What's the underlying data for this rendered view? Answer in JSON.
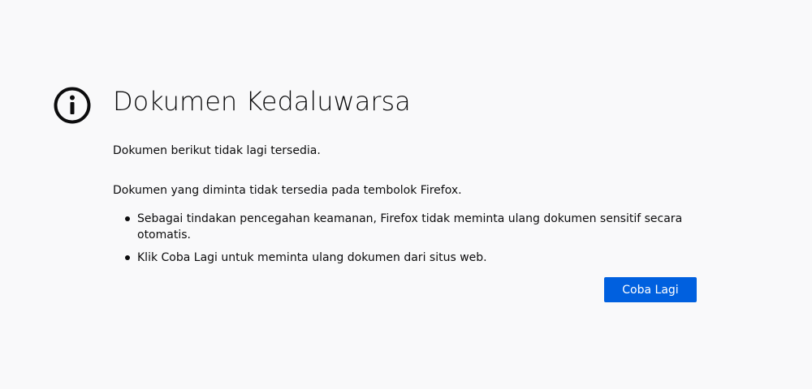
{
  "error": {
    "icon": "info-icon",
    "title": "Dokumen Kedaluwarsa",
    "short_desc": "Dokumen berikut tidak lagi tersedia.",
    "long_intro": "Dokumen yang diminta tidak tersedia pada tembolok Firefox.",
    "bullets": [
      "Sebagai tindakan pencegahan keamanan, Firefox tidak meminta ulang dokumen sensitif secara otomatis.",
      "Klik Coba Lagi untuk meminta ulang dokumen dari situs web."
    ],
    "button_label": "Coba Lagi"
  },
  "colors": {
    "background": "#f9f9fa",
    "text": "#0c0c0d",
    "button": "#0060df",
    "button_text": "#ffffff"
  }
}
